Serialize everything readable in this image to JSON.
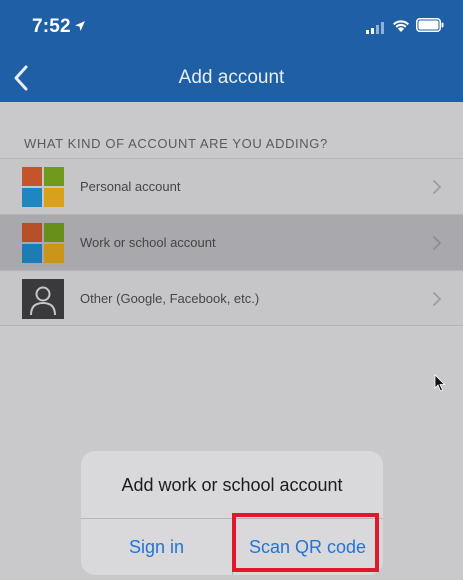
{
  "status_bar": {
    "time": "7:52",
    "icons": [
      "location-arrow-icon",
      "signal-icon",
      "wifi-icon",
      "battery-icon"
    ]
  },
  "nav": {
    "title": "Add account",
    "back_icon": "chevron-left-icon"
  },
  "section": {
    "header": "WHAT KIND OF ACCOUNT ARE YOU ADDING?"
  },
  "accounts": [
    {
      "label": "Personal account",
      "icon": "microsoft-logo-icon",
      "selected": false
    },
    {
      "label": "Work or school account",
      "icon": "microsoft-logo-icon",
      "selected": true
    },
    {
      "label": "Other (Google, Facebook, etc.)",
      "icon": "person-icon",
      "selected": false
    }
  ],
  "dialog": {
    "title": "Add work or school account",
    "sign_in_label": "Sign in",
    "scan_qr_label": "Scan QR code"
  },
  "colors": {
    "nav_bg": "#1f5fa6",
    "dimmed_bg": "#c9c9cb",
    "dialog_button": "#2374d6",
    "highlight": "#e1182a",
    "ms_red": "#f25022",
    "ms_green": "#7fba00",
    "ms_blue": "#00a4ef",
    "ms_yellow": "#ffb900"
  }
}
